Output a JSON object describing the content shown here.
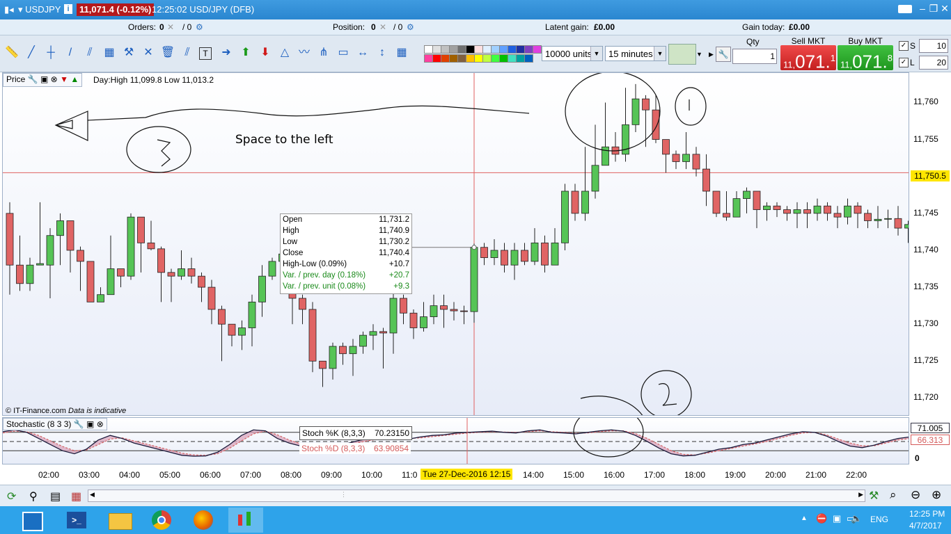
{
  "window": {
    "symbol": "USDJPY",
    "price_change": "11,071.4 (-0.12%)",
    "title": "12:25:02 USD/JPY (DFB)"
  },
  "status": {
    "orders_label": "Orders:",
    "orders_value": "0",
    "orders_total": "/ 0",
    "position_label": "Position:",
    "position_value": "0",
    "position_total": "/ 0",
    "latent_gain_label": "Latent gain:",
    "latent_gain_value": "£0.00",
    "gain_today_label": "Gain today:",
    "gain_today_value": "£0.00"
  },
  "toolbar": {
    "units": "10000 units",
    "timeframe": "15 minutes",
    "qty_label": "Qty",
    "qty_value": "1",
    "sell_label": "Sell MKT",
    "sell_price_small": "11,",
    "sell_price_big": "071.",
    "sell_price_sup": "1",
    "buy_label": "Buy MKT",
    "buy_price_small": "11,",
    "buy_price_big": "071.",
    "buy_price_sup": "8",
    "s_label": "S",
    "s_value": "10",
    "l_label": "L",
    "l_value": "20",
    "palette": [
      "#ffffff",
      "#e0e0e0",
      "#c0c0c0",
      "#a0a0a0",
      "#707070",
      "#000000",
      "#ffe0e0",
      "#e0f0ff",
      "#a0d0ff",
      "#60a0ff",
      "#2060e0",
      "#2030a0",
      "#8040c0",
      "#e040e0",
      "#ff40a0",
      "#ff0000",
      "#e04000",
      "#a06000",
      "#806040",
      "#ffc000",
      "#ffff00",
      "#c0ff40",
      "#40ff40",
      "#00c000",
      "#40e0c0",
      "#00a0a0",
      "#0060c0"
    ]
  },
  "price_panel": {
    "label": "Price",
    "day_info": "Day:High 11,099.8 Low 11,013.2",
    "annotation": "Space to the left",
    "watermark_source": "© IT-Finance.com",
    "watermark_note": "Data is indicative",
    "current_price_tag": "11,750.5"
  },
  "tooltip": {
    "rows": [
      {
        "k": "Open",
        "v": "11,731.2",
        "color": "#000"
      },
      {
        "k": "High",
        "v": "11,740.9",
        "color": "#000"
      },
      {
        "k": "Low",
        "v": "11,730.2",
        "color": "#000"
      },
      {
        "k": "Close",
        "v": "11,740.4",
        "color": "#000"
      },
      {
        "k": "High-Low (0.09%)",
        "v": "+10.7",
        "color": "#000"
      },
      {
        "k": "Var. / prev. day (0.18%)",
        "v": "+20.7",
        "color": "#1a8a1a"
      },
      {
        "k": "Var. / prev. unit (0.08%)",
        "v": "+9.3",
        "color": "#1a8a1a"
      }
    ]
  },
  "stoch_panel": {
    "label": "Stochastic (8 3 3)",
    "k_label": "Stoch %K (8,3,3)",
    "k_value": "70.23150",
    "d_label": "Stoch %D (8,3,3)",
    "d_value": "63.90854",
    "k_tag": "71.005",
    "d_tag": "66.313",
    "zero_tag": "0"
  },
  "crosshair_date": "Tue 27-Dec-2016 12:15",
  "taskbar": {
    "lang": "ENG",
    "time": "12:25 PM",
    "date": "4/7/2017"
  },
  "chart_data": {
    "type": "candlestick",
    "yticks": [
      11720,
      11725,
      11730,
      11735,
      11740,
      11745,
      11750,
      11755,
      11760
    ],
    "ytick_labels": [
      "11,720",
      "11,725",
      "11,730",
      "11,735",
      "11,740",
      "11,745",
      "11,750",
      "11,755",
      "11,760"
    ],
    "ylim": [
      11717.5,
      11764
    ],
    "xtick_labels": [
      "02:00",
      "03:00",
      "04:00",
      "05:00",
      "06:00",
      "07:00",
      "08:00",
      "09:00",
      "10:00",
      "11:0",
      "14:00",
      "15:00",
      "16:00",
      "17:00",
      "18:00",
      "19:00",
      "20:00",
      "21:00",
      "22:00"
    ],
    "xtick_index": [
      4,
      8,
      12,
      16,
      20,
      24,
      28,
      32,
      36,
      40,
      52,
      56,
      60,
      64,
      68,
      72,
      76,
      80,
      84
    ],
    "candles": [
      [
        11745,
        11738,
        11746.5,
        11734
      ],
      [
        11738,
        11735.5,
        11742,
        11734.5
      ],
      [
        11735.5,
        11738,
        11739,
        11734.5
      ],
      [
        11738,
        11738.2,
        11746.5,
        11738
      ],
      [
        11738,
        11742,
        11743,
        11733.5
      ],
      [
        11742,
        11744,
        11745,
        11738
      ],
      [
        11744,
        11740,
        11744,
        11737
      ],
      [
        11740,
        11738.5,
        11740.5,
        11734.5
      ],
      [
        11738.5,
        11733,
        11738.5,
        11733
      ],
      [
        11733,
        11734,
        11735,
        11733
      ],
      [
        11734,
        11737.5,
        11742,
        11734
      ],
      [
        11737.5,
        11736.5,
        11737.5,
        11735
      ],
      [
        11736.5,
        11744.5,
        11745,
        11736
      ],
      [
        11744.5,
        11741,
        11744.5,
        11737
      ],
      [
        11741,
        11740.2,
        11744,
        11740
      ],
      [
        11740.2,
        11737,
        11740.5,
        11733
      ],
      [
        11737,
        11736.5,
        11737.5,
        11733
      ],
      [
        11736.5,
        11737.5,
        11740,
        11736
      ],
      [
        11737.5,
        11736.5,
        11739,
        11735.5
      ],
      [
        11736.5,
        11735,
        11737,
        11733
      ],
      [
        11735,
        11732,
        11736,
        11730
      ],
      [
        11732,
        11730,
        11732.5,
        11725
      ],
      [
        11730,
        11728.5,
        11730,
        11727
      ],
      [
        11728.5,
        11729.5,
        11730.5,
        11726.5
      ],
      [
        11729.5,
        11733,
        11734,
        11727
      ],
      [
        11733,
        11736.5,
        11738,
        11731
      ],
      [
        11736.5,
        11738.5,
        11739,
        11736
      ],
      [
        11738.5,
        11739.5,
        11740,
        11738
      ],
      [
        11739.5,
        11733.5,
        11740.5,
        11730
      ],
      [
        11733.5,
        11732,
        11734,
        11730
      ],
      [
        11732,
        11725,
        11733,
        11723.5
      ],
      [
        11725,
        11724,
        11725,
        11721.5
      ],
      [
        11724,
        11727,
        11727.5,
        11722.5
      ],
      [
        11727,
        11726,
        11727.5,
        11724.5
      ],
      [
        11726,
        11727,
        11728,
        11723
      ],
      [
        11727,
        11728.5,
        11729,
        11726
      ],
      [
        11728.5,
        11729,
        11730,
        11726.5
      ],
      [
        11729,
        11728.8,
        11729.5,
        11724
      ],
      [
        11728.8,
        11733.5,
        11735,
        11726
      ],
      [
        11733.5,
        11731.5,
        11734,
        11730
      ],
      [
        11731.5,
        11729.5,
        11732,
        11728
      ],
      [
        11729.5,
        11731,
        11733,
        11729
      ],
      [
        11731,
        11732.5,
        11734,
        11730
      ],
      [
        11732.5,
        11732,
        11734,
        11729.5
      ],
      [
        11732,
        11731.8,
        11733,
        11730.5
      ],
      [
        11731.8,
        11731.7,
        11732.5,
        11730
      ],
      [
        11731.7,
        11740.4,
        11740.9,
        11730.2
      ],
      [
        11740.4,
        11739,
        11741,
        11738
      ],
      [
        11739,
        11740,
        11741.5,
        11738
      ],
      [
        11740,
        11738,
        11741,
        11737
      ],
      [
        11738,
        11740,
        11741,
        11736
      ],
      [
        11740,
        11738.5,
        11741,
        11738
      ],
      [
        11738.5,
        11741,
        11743,
        11738
      ],
      [
        11741,
        11738,
        11742,
        11737
      ],
      [
        11738,
        11741,
        11743,
        11738
      ],
      [
        11741,
        11748,
        11749,
        11740
      ],
      [
        11748,
        11745,
        11749,
        11744
      ],
      [
        11745,
        11748,
        11754,
        11744
      ],
      [
        11748,
        11751.5,
        11757,
        11747
      ],
      [
        11751.5,
        11754,
        11760,
        11753
      ],
      [
        11754,
        11753,
        11756,
        11752
      ],
      [
        11753,
        11757,
        11762,
        11752
      ],
      [
        11757,
        11760.5,
        11762.5,
        11756
      ],
      [
        11760.5,
        11759,
        11761,
        11754
      ],
      [
        11759,
        11755,
        11761,
        11754.5
      ],
      [
        11755,
        11753,
        11755,
        11750.5
      ],
      [
        11753,
        11752,
        11753.5,
        11751
      ],
      [
        11752,
        11753,
        11756,
        11751
      ],
      [
        11753,
        11751,
        11754,
        11750
      ],
      [
        11751,
        11748,
        11753,
        11746
      ],
      [
        11748,
        11745,
        11748,
        11744.5
      ],
      [
        11745,
        11744.5,
        11748,
        11744
      ],
      [
        11744.5,
        11747,
        11748,
        11744.5
      ],
      [
        11747,
        11748,
        11748.5,
        11745
      ],
      [
        11748,
        11745.5,
        11748,
        11743
      ],
      [
        11745.5,
        11746,
        11746.5,
        11744
      ],
      [
        11746,
        11745.5,
        11746.5,
        11744.5
      ],
      [
        11745.5,
        11745,
        11746,
        11744
      ],
      [
        11745,
        11745.5,
        11746.5,
        11743
      ],
      [
        11745.5,
        11745,
        11746.5,
        11743
      ],
      [
        11745,
        11746,
        11747,
        11744
      ],
      [
        11746,
        11745,
        11746.5,
        11744
      ],
      [
        11745,
        11744.5,
        11746,
        11743
      ],
      [
        11744.5,
        11746,
        11747,
        11743.5
      ],
      [
        11746,
        11745,
        11746.5,
        11743
      ],
      [
        11745,
        11744,
        11745.5,
        11743
      ],
      [
        11744,
        11744.2,
        11746,
        11743
      ],
      [
        11744.2,
        11744.3,
        11745.5,
        11743
      ],
      [
        11744.3,
        11743,
        11746,
        11742
      ],
      [
        11743,
        11743.5,
        11744,
        11741
      ],
      [
        11743.5,
        11744,
        11744.5,
        11741.5
      ],
      [
        11744,
        11745,
        11745.5,
        11743
      ],
      [
        11745,
        11747,
        11749,
        11743
      ],
      [
        11747,
        11747.5,
        11751,
        11744
      ]
    ],
    "stoch_k": [
      82,
      88,
      80,
      60,
      40,
      20,
      10,
      25,
      55,
      70,
      60,
      45,
      35,
      25,
      15,
      5,
      2,
      3,
      15,
      40,
      70,
      88,
      85,
      60,
      45,
      35,
      30,
      30,
      35,
      45,
      55,
      60,
      62,
      60,
      58,
      65,
      70,
      72,
      78,
      80,
      82,
      84,
      80,
      78,
      85,
      88,
      80,
      78,
      75,
      80,
      85,
      88,
      84,
      70,
      50,
      28,
      10,
      3,
      5,
      15,
      25,
      30,
      40,
      45,
      55,
      65,
      75,
      82,
      80,
      68,
      50,
      35,
      30,
      38,
      50,
      60,
      65
    ],
    "stoch_d": [
      78,
      84,
      82,
      70,
      52,
      34,
      20,
      22,
      40,
      58,
      62,
      52,
      42,
      32,
      22,
      12,
      6,
      5,
      10,
      28,
      52,
      75,
      84,
      72,
      55,
      42,
      35,
      32,
      33,
      40,
      48,
      55,
      60,
      61,
      60,
      62,
      66,
      70,
      74,
      78,
      80,
      82,
      81,
      80,
      82,
      85,
      82,
      80,
      77,
      78,
      82,
      85,
      85,
      76,
      60,
      40,
      20,
      8,
      6,
      12,
      20,
      27,
      35,
      42,
      50,
      60,
      70,
      78,
      80,
      72,
      58,
      45,
      36,
      36,
      45,
      55,
      60
    ],
    "stoch_k_line_level": 80,
    "stoch_d_line_level": 50
  }
}
